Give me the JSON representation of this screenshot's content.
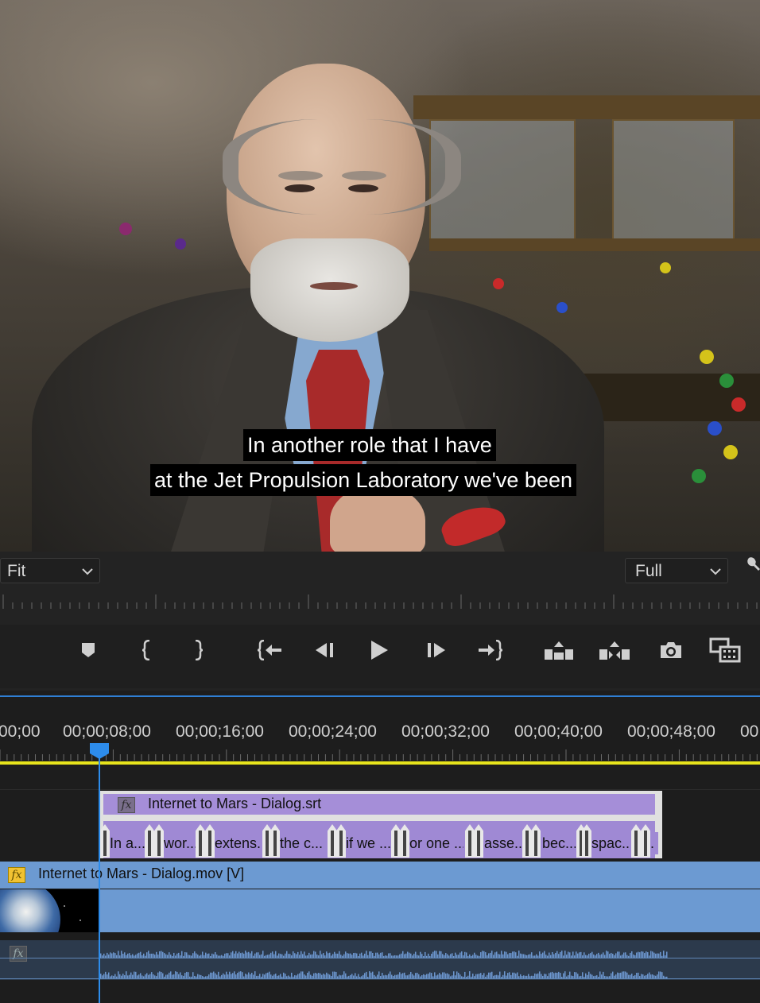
{
  "monitor": {
    "subtitle_line1": "In another role that I have",
    "subtitle_line2": "at the Jet Propulsion Laboratory we've been",
    "zoom_dropdown": "Fit",
    "resolution_dropdown": "Full"
  },
  "transport": {
    "buttons": [
      "add-marker",
      "mark-in",
      "mark-out",
      "go-to-in",
      "step-back",
      "play",
      "step-forward",
      "go-to-out",
      "lift",
      "extract",
      "export-frame",
      "compare-view"
    ]
  },
  "timeline": {
    "timecodes": [
      "00;00",
      "00;00;08;00",
      "00;00;16;00",
      "00;00;24;00",
      "00;00;32;00",
      "00;00;40;00",
      "00;00;48;00",
      "00"
    ],
    "caption_track": {
      "fx_label": "fx",
      "clip_name": "Internet to Mars - Dialog.srt",
      "segments": [
        "In a...",
        "wor...",
        "extens...",
        "the c...",
        "if we ...",
        "or one ...",
        "asse...",
        "bec...",
        "spac...",
        "."
      ]
    },
    "video_track": {
      "fx_label": "fx",
      "clip_name": "Internet to Mars - Dialog.mov [V]"
    },
    "audio_track": {
      "fx_label": "fx"
    }
  },
  "colors": {
    "playhead": "#2d8ceb",
    "work_area": "#e7e41c",
    "caption_clip": "#a58ed8",
    "video_clip": "#6c9ad2"
  }
}
